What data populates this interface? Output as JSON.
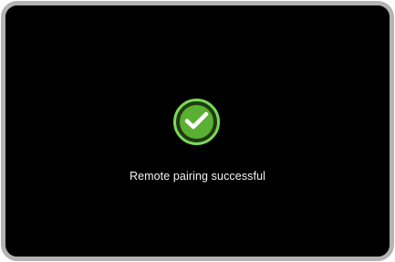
{
  "dialog": {
    "message": "Remote pairing successful",
    "icon": "checkmark-circle-icon",
    "status": "success"
  },
  "colors": {
    "background": "#000000",
    "text": "#f2f2f2",
    "accent": "#5ab030",
    "accent_ring": "#7ed957",
    "frame": "#b3b3b3"
  }
}
